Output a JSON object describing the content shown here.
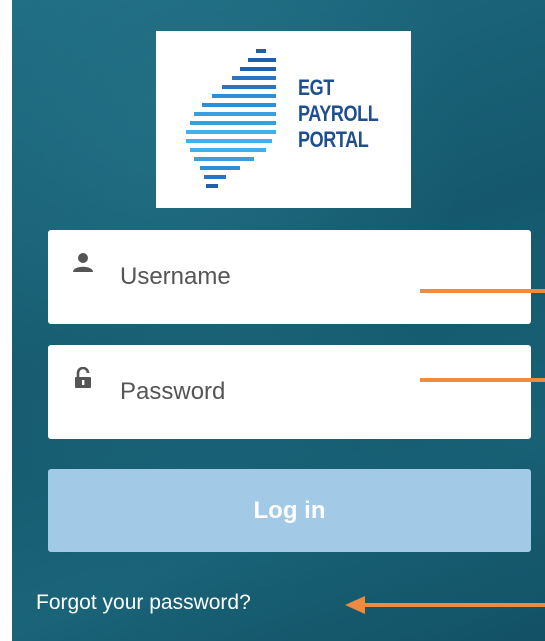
{
  "logo": {
    "line1": "EGT",
    "line2": "PAYROLL",
    "line3": "PORTAL",
    "brand_color": "#1f4f8f",
    "stripe_colors": [
      "#1f5fae",
      "#2f8fd6",
      "#3fb0e8"
    ]
  },
  "form": {
    "username": {
      "placeholder": "Username",
      "value": "",
      "icon": "person-icon"
    },
    "password": {
      "placeholder": "Password",
      "value": "",
      "icon": "lock-icon"
    },
    "login_label": "Log in",
    "forgot_label": "Forgot your password?"
  },
  "colors": {
    "background": "#15586d",
    "button": "#a2c9e6",
    "annotation_arrow": "#f08a3c"
  }
}
